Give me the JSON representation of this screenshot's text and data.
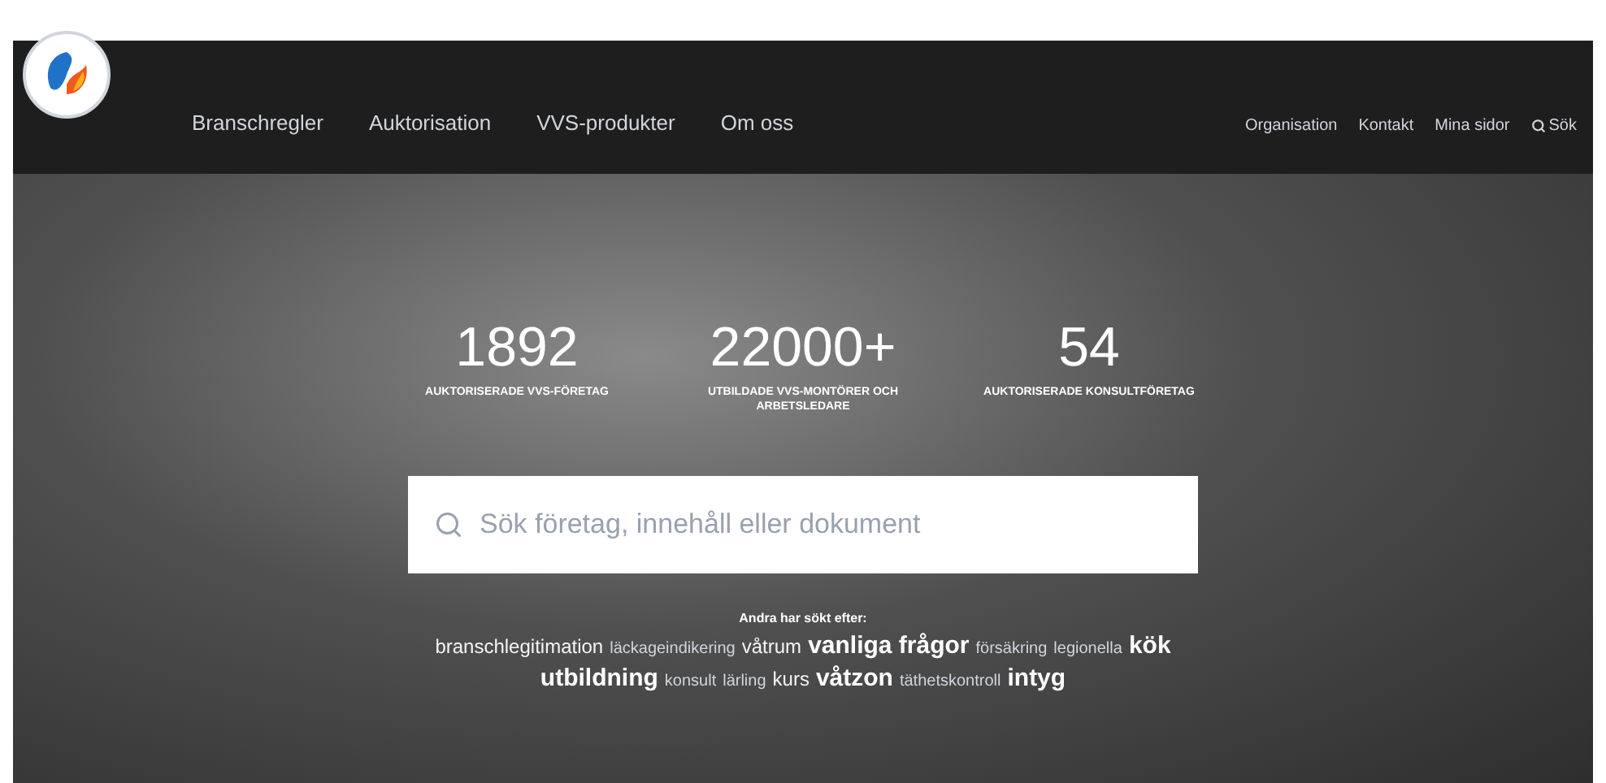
{
  "nav": {
    "main": [
      "Branschregler",
      "Auktorisation",
      "VVS-produkter",
      "Om oss"
    ],
    "secondary": [
      "Organisation",
      "Kontakt",
      "Mina sidor"
    ],
    "search_link": "Sök"
  },
  "stats": [
    {
      "number": "1892",
      "label": "AUKTORISERADE VVS-FÖRETAG"
    },
    {
      "number": "22000+",
      "label": "UTBILDADE VVS-MONTÖRER OCH ARBETSLEDARE"
    },
    {
      "number": "54",
      "label": "AUKTORISERADE KONSULTFÖRETAG"
    }
  ],
  "search": {
    "placeholder": "Sök företag, innehåll eller dokument"
  },
  "popular": {
    "heading": "Andra har sökt efter:",
    "tags": [
      {
        "text": "branschlegitimation",
        "kind": "medium"
      },
      {
        "text": "läckageindikering",
        "kind": "small"
      },
      {
        "text": "våtrum",
        "kind": "medium"
      },
      {
        "text": "vanliga frågor",
        "kind": "large"
      },
      {
        "text": "försäkring",
        "kind": "small"
      },
      {
        "text": "legionella",
        "kind": "small"
      },
      {
        "text": "kök",
        "kind": "large"
      },
      {
        "text": "utbildning",
        "kind": "large"
      },
      {
        "text": "konsult",
        "kind": "small"
      },
      {
        "text": "lärling",
        "kind": "small"
      },
      {
        "text": "kurs",
        "kind": "medium"
      },
      {
        "text": "våtzon",
        "kind": "large"
      },
      {
        "text": "täthetskontroll",
        "kind": "small"
      },
      {
        "text": "intyg",
        "kind": "large"
      }
    ]
  }
}
